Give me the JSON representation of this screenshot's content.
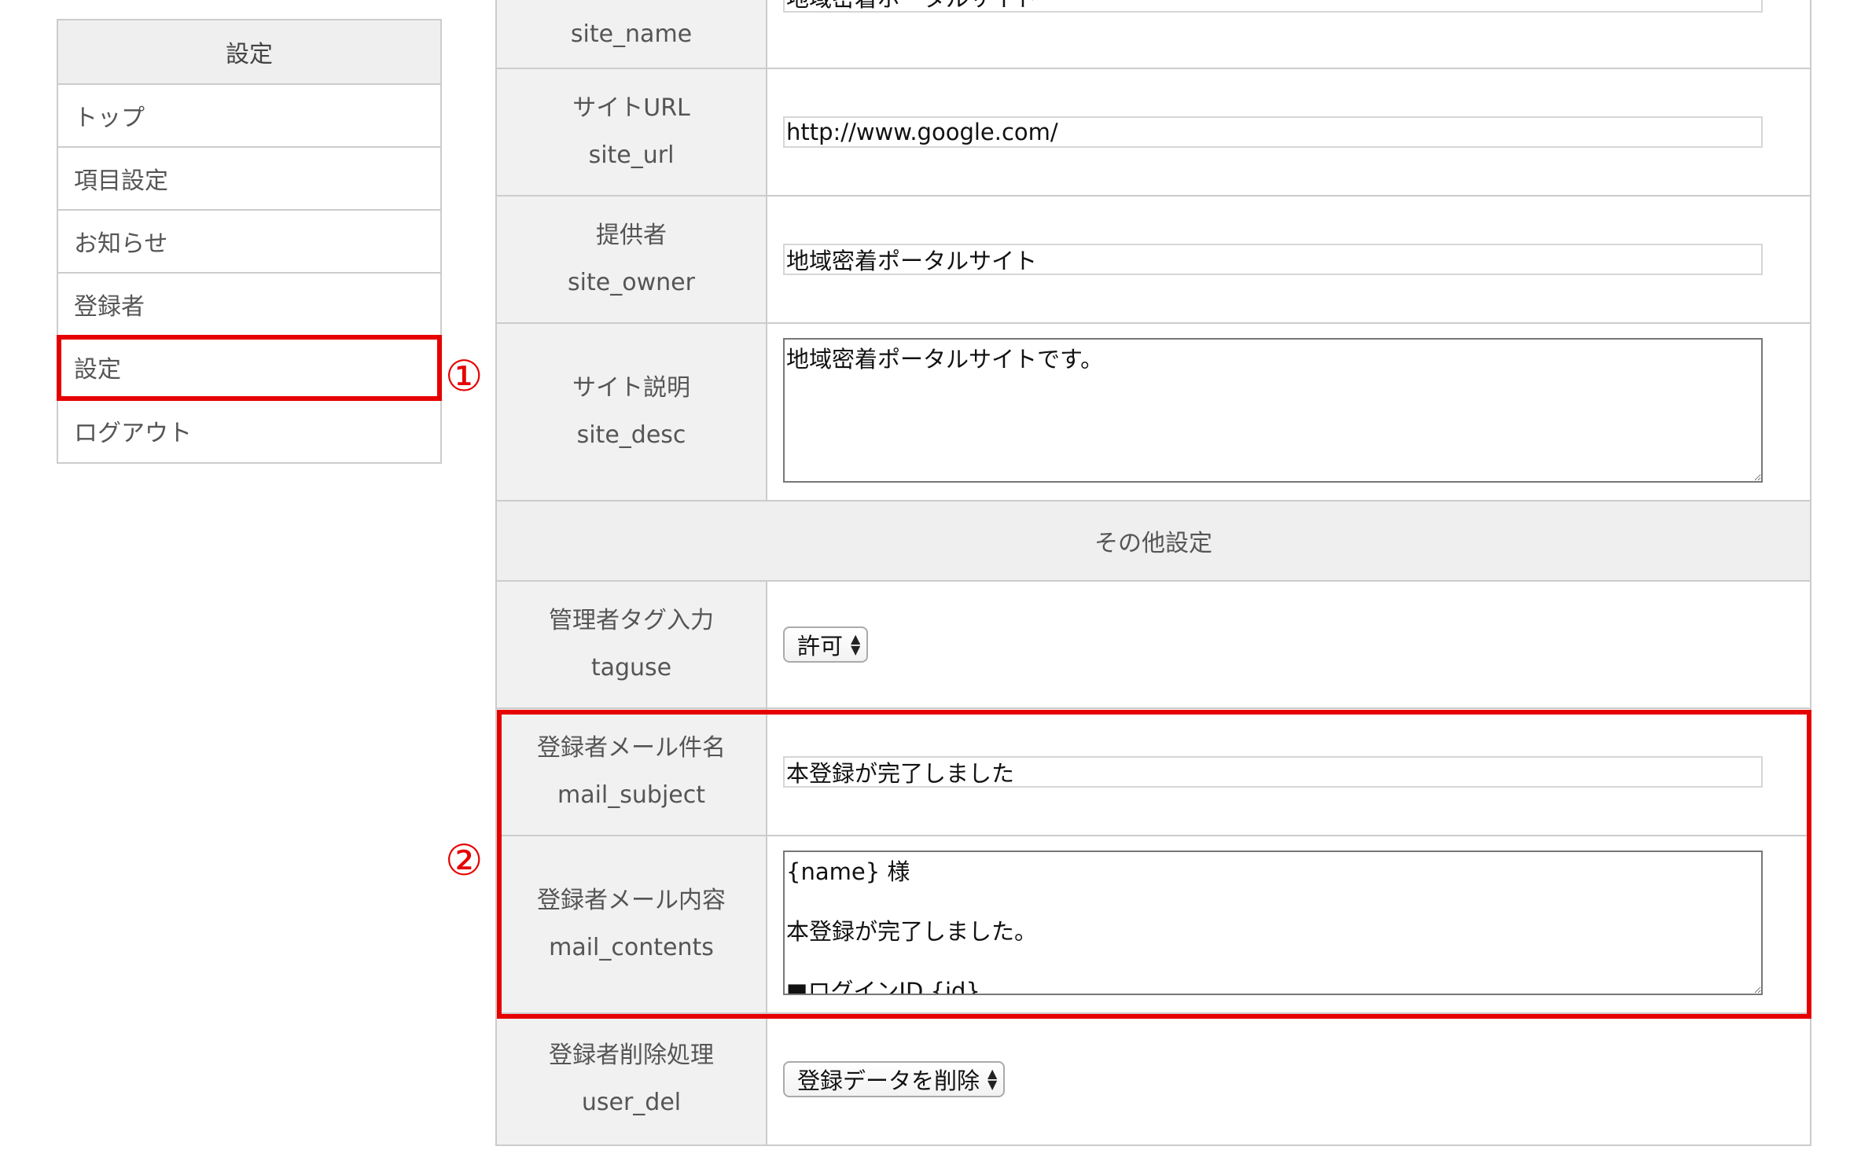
{
  "sidebar": {
    "header": "設定",
    "items": [
      {
        "label": "トップ"
      },
      {
        "label": "項目設定"
      },
      {
        "label": "お知らせ"
      },
      {
        "label": "登録者"
      },
      {
        "label": "設定"
      },
      {
        "label": "ログアウト"
      }
    ],
    "active_index": 4
  },
  "markers": {
    "one": "①",
    "two": "②"
  },
  "settings": {
    "site_name": {
      "key": "site_name",
      "value": "地域密着ポータルサイト"
    },
    "site_url": {
      "label": "サイトURL",
      "key": "site_url",
      "value": "http://www.google.com/"
    },
    "site_owner": {
      "label": "提供者",
      "key": "site_owner",
      "value": "地域密着ポータルサイト"
    },
    "site_desc": {
      "label": "サイト説明",
      "key": "site_desc",
      "value": "地域密着ポータルサイトです。"
    },
    "section_other": "その他設定",
    "taguse": {
      "label": "管理者タグ入力",
      "key": "taguse",
      "value": "許可"
    },
    "mail_subject": {
      "label": "登録者メール件名",
      "key": "mail_subject",
      "value": "本登録が完了しました"
    },
    "mail_contents": {
      "label": "登録者メール内容",
      "key": "mail_contents",
      "value": "{name} 様\n\n本登録が完了しました。\n\n■ログインID {id}"
    },
    "user_del": {
      "label": "登録者削除処理",
      "key": "user_del",
      "value": "登録データを削除"
    }
  },
  "colors": {
    "highlight": "#e60000",
    "border": "#cccccc",
    "label_bg": "#f1f1f1"
  }
}
